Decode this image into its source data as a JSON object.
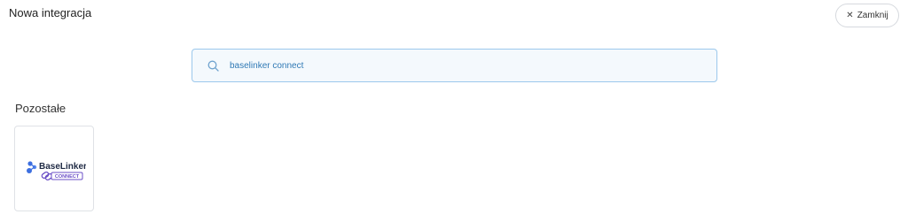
{
  "header": {
    "title": "Nowa integracja",
    "close_label": "Zamknij"
  },
  "search": {
    "value": "baselinker connect",
    "placeholder": ""
  },
  "results": {
    "section_label": "Pozostałe",
    "items": [
      {
        "name": "BaseLinker CONNECT",
        "logo_text": "BaseLinker",
        "logo_subtext": "CONNECT"
      }
    ]
  },
  "colors": {
    "accent": "#2f79b5",
    "search_border": "#9cc8ec",
    "search_bg": "#f4f9fd",
    "logo_blue": "#3d6fe0",
    "logo_purple": "#6b4fc7"
  },
  "icons": [
    "search-icon",
    "close-icon",
    "baselinker-logo"
  ]
}
